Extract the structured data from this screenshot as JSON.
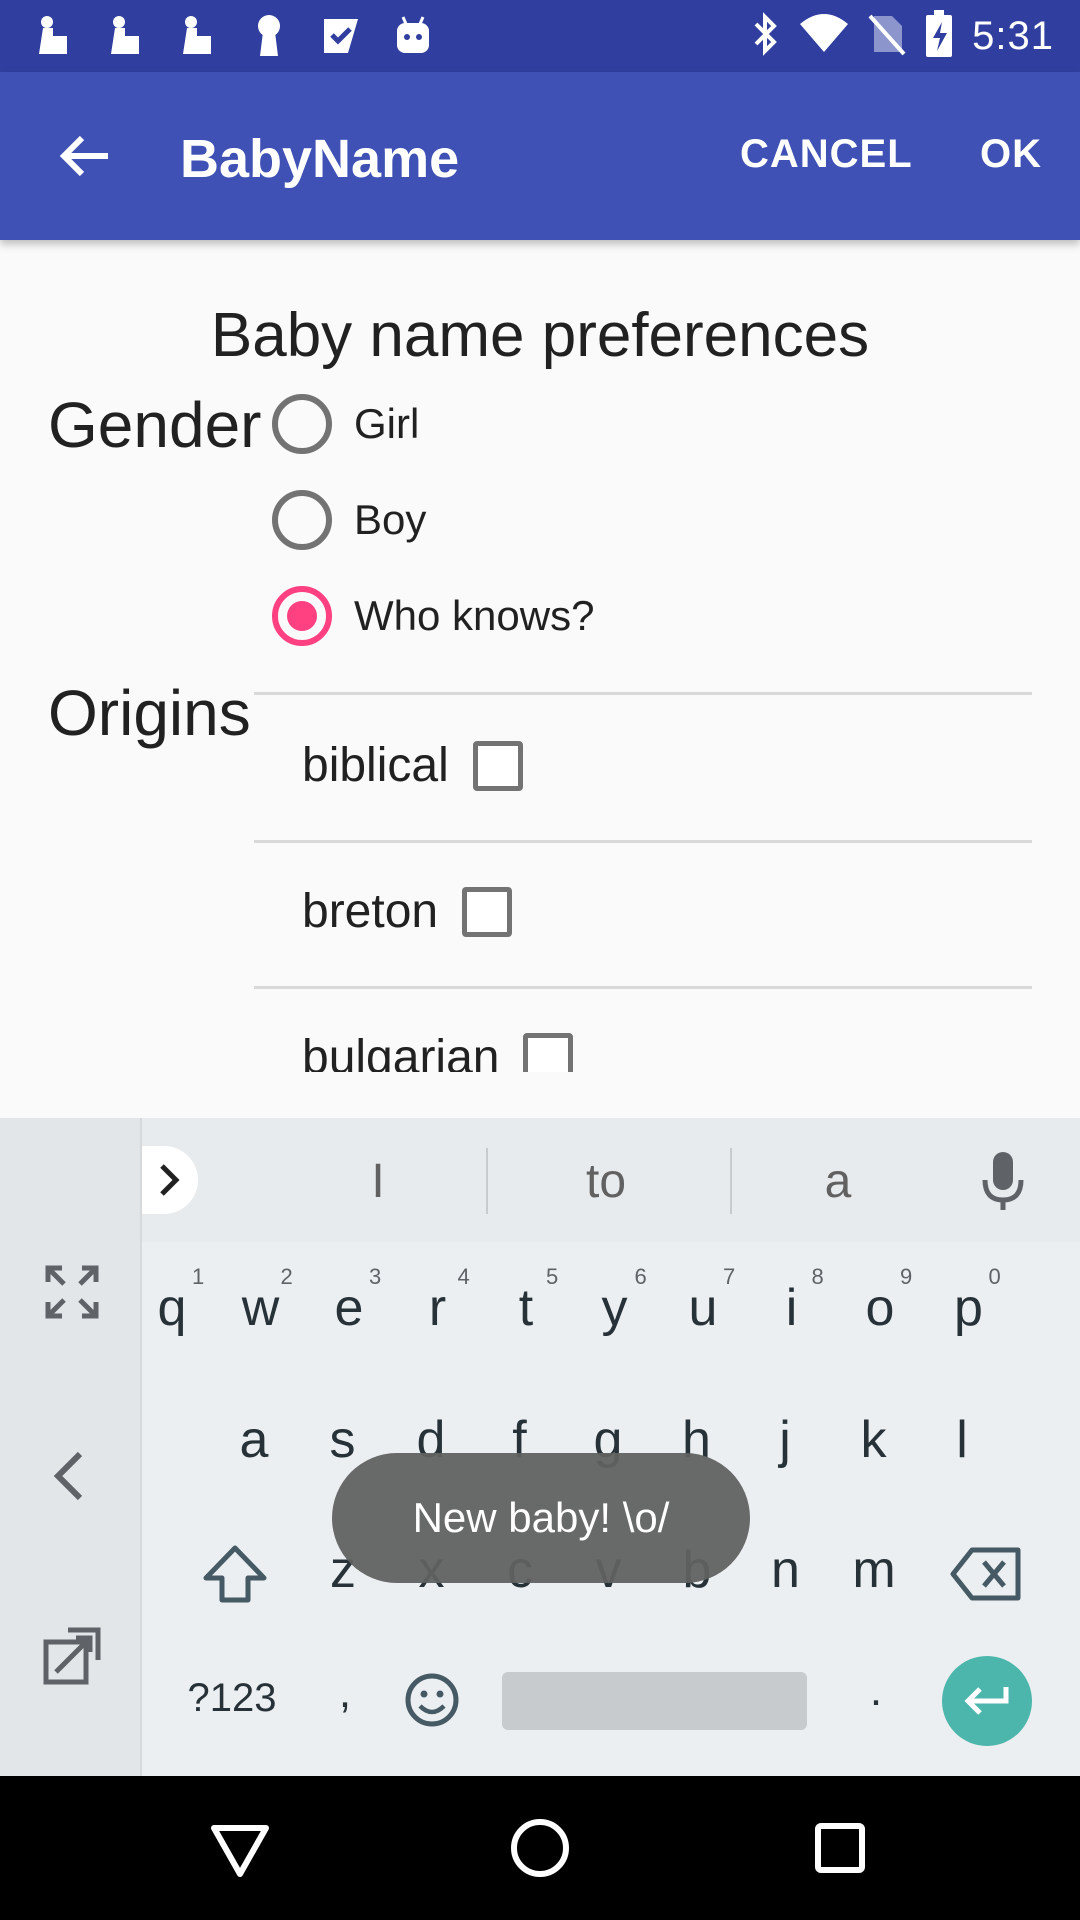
{
  "status_bar": {
    "time": "5:31",
    "left_icons": [
      "hand-icon",
      "hand-icon",
      "hand-icon",
      "keyhole-icon",
      "checkmark-icon",
      "android-icon"
    ],
    "right_icons": [
      "bluetooth-icon",
      "wifi-icon",
      "no-sim-icon",
      "battery-charging-icon"
    ]
  },
  "app_bar": {
    "title": "BabyName",
    "cancel_label": "CANCEL",
    "ok_label": "OK"
  },
  "form": {
    "heading": "Baby name preferences",
    "gender_label": "Gender",
    "gender_options": [
      {
        "label": "Girl",
        "checked": false
      },
      {
        "label": "Boy",
        "checked": false
      },
      {
        "label": "Who knows?",
        "checked": true
      }
    ],
    "origins_label": "Origins",
    "origins": [
      {
        "label": "biblical",
        "checked": false
      },
      {
        "label": "breton",
        "checked": false
      },
      {
        "label": "bulgarian",
        "checked": false
      }
    ]
  },
  "keyboard": {
    "suggestions": [
      "I",
      "to",
      "a"
    ],
    "row1": [
      "q",
      "w",
      "e",
      "r",
      "t",
      "y",
      "u",
      "i",
      "o",
      "p"
    ],
    "row1_hints": [
      "1",
      "2",
      "3",
      "4",
      "5",
      "6",
      "7",
      "8",
      "9",
      "0"
    ],
    "row2": [
      "a",
      "s",
      "d",
      "f",
      "g",
      "h",
      "j",
      "k",
      "l"
    ],
    "row3": [
      "z",
      "x",
      "c",
      "v",
      "b",
      "n",
      "m"
    ],
    "symbols_label": "?123",
    "comma": ",",
    "period": "."
  },
  "toast": {
    "text": "New baby! \\o/"
  },
  "colors": {
    "status_bar": "#303f9f",
    "app_bar": "#3f51b5",
    "accent": "#ff4081",
    "enter_key": "#4db6ac"
  }
}
